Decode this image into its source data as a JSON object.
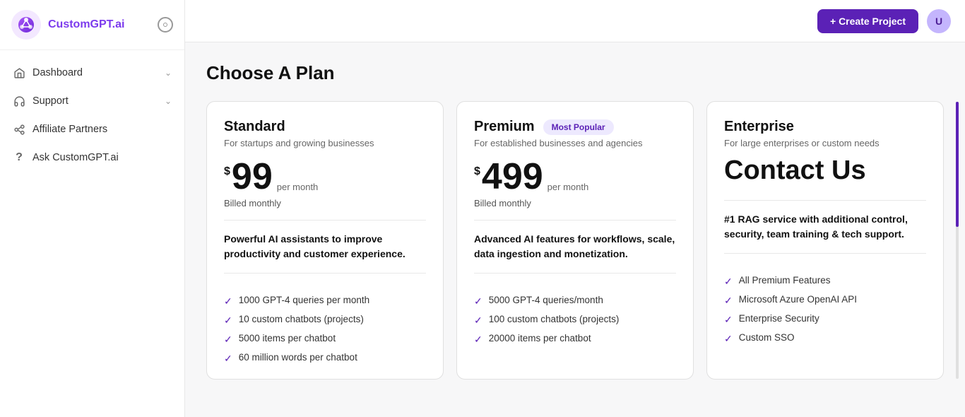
{
  "sidebar": {
    "logo_text": "CustomGPT.ai",
    "nav_items": [
      {
        "id": "dashboard",
        "label": "Dashboard",
        "icon": "home",
        "has_chevron": true
      },
      {
        "id": "support",
        "label": "Support",
        "icon": "headset",
        "has_chevron": true
      },
      {
        "id": "affiliate",
        "label": "Affiliate Partners",
        "icon": "affiliate",
        "has_chevron": false
      },
      {
        "id": "ask",
        "label": "Ask CustomGPT.ai",
        "icon": "question",
        "has_chevron": false
      }
    ]
  },
  "topbar": {
    "create_button_label": "+ Create Project",
    "user_initial": "U"
  },
  "main": {
    "page_title": "Choose A Plan",
    "plans": [
      {
        "id": "standard",
        "name": "Standard",
        "subtitle": "For startups and growing businesses",
        "price_dollar": "$",
        "price_amount": "99",
        "price_period": "per month",
        "price_billed": "Billed monthly",
        "popular_badge": null,
        "description": "Powerful AI assistants to improve productivity and customer experience.",
        "features": [
          "1000 GPT-4 queries per month",
          "10 custom chatbots (projects)",
          "5000 items per chatbot",
          "60 million words per chatbot"
        ]
      },
      {
        "id": "premium",
        "name": "Premium",
        "subtitle": "For established businesses and agencies",
        "price_dollar": "$",
        "price_amount": "499",
        "price_period": "per month",
        "price_billed": "Billed monthly",
        "popular_badge": "Most Popular",
        "description": "Advanced AI features for workflows, scale, data ingestion and monetization.",
        "features": [
          "5000 GPT-4 queries/month",
          "100 custom chatbots (projects)",
          "20000 items per chatbot",
          ""
        ]
      },
      {
        "id": "enterprise",
        "name": "Enterprise",
        "subtitle": "For large enterprises or custom needs",
        "price_dollar": null,
        "price_amount": null,
        "price_period": null,
        "price_billed": null,
        "popular_badge": null,
        "contact_us": "Contact Us",
        "description": "#1 RAG service with additional control, security, team training & tech support.",
        "features": [
          "All Premium Features",
          "Microsoft Azure OpenAI API",
          "Enterprise Security",
          "Custom SSO"
        ]
      }
    ]
  }
}
